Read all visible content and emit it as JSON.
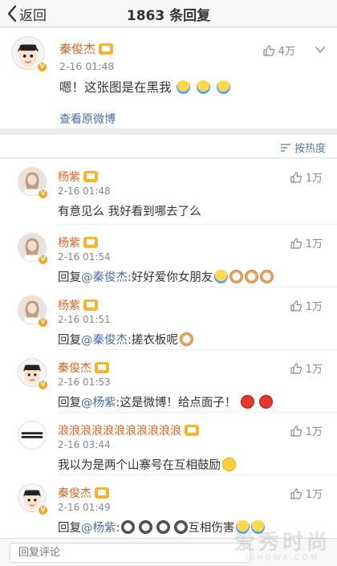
{
  "header": {
    "back_label": "返回",
    "title": "1863 条回复"
  },
  "original_post": {
    "author": "秦俊杰",
    "time": "2-16 01:48",
    "likes": "4万",
    "text": "嗯！这张图是在黑我",
    "emojis": [
      "chick-emoji",
      "chick-emoji",
      "chick-emoji"
    ],
    "view_original_label": "查看原微博"
  },
  "sort": {
    "label": "按热度"
  },
  "comments": [
    {
      "author": "杨紫",
      "time": "2-16 01:48",
      "likes": "1万",
      "text": "有意见么 我好看到哪去了么"
    },
    {
      "author": "杨紫",
      "time": "2-16 01:54",
      "likes": "1万",
      "prefix": "回复",
      "mention": "@秦俊杰",
      "text": ":好好爱你女朋友"
    },
    {
      "author": "杨紫",
      "time": "2-16 01:51",
      "likes": "1万",
      "prefix": "回复",
      "mention": "@秦俊杰",
      "text": ":搓衣板呢"
    },
    {
      "author": "秦俊杰",
      "time": "2-16 01:53",
      "likes": "1万",
      "prefix": "回复",
      "mention": "@杨紫",
      "text": ":这是微博！给点面子！"
    },
    {
      "author": "浪浪浪浪浪浪浪浪浪浪浪",
      "time": "2-16 03:44",
      "likes": "1万",
      "text": "我以为是两个山寨号在互相鼓励"
    },
    {
      "author": "秦俊杰",
      "time": "2-16 01:49",
      "likes": "1万",
      "prefix": "回复",
      "mention": "@杨紫",
      "text": ":",
      "suffix": "互相伤害"
    }
  ],
  "reply_input": {
    "placeholder": "回复评论"
  },
  "watermark": {
    "main": "爱秀时尚",
    "sub": "ISHOWX.COM"
  },
  "colors": {
    "username": "#e8601c",
    "link": "#4a6ea9",
    "badge": "#f5a623"
  }
}
